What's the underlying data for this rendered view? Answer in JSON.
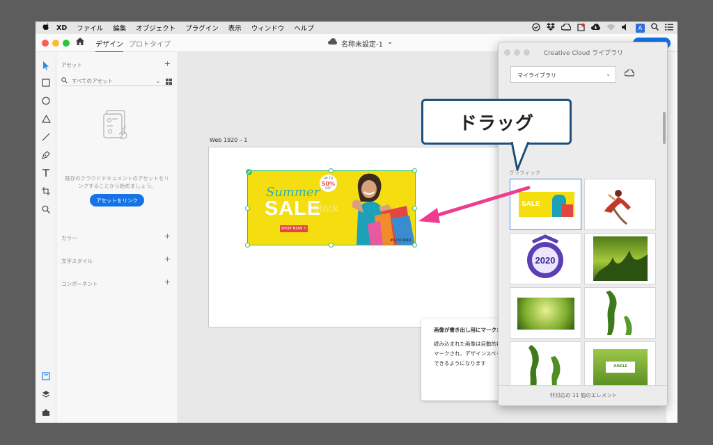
{
  "menubar": {
    "apple": "",
    "items": [
      "XD",
      "ファイル",
      "編集",
      "オブジェクト",
      "プラグイン",
      "表示",
      "ウィンドウ",
      "ヘルプ"
    ],
    "input_badge": "A"
  },
  "titlebar": {
    "tab_design": "デザイン",
    "tab_prototype": "プロトタイプ",
    "doc_title": "名称未設定-1",
    "chevron": "⌄"
  },
  "assets": {
    "header": "アセット",
    "plus": "+",
    "search_label": "すべてのアセット",
    "chevron": "⌄",
    "empty_text": "既存のクラウドドキュメントのアセットをリンクすることから始めましょう。",
    "link_button": "アセットをリンク",
    "sections": [
      "カラー",
      "文字スタイル",
      "コンポーネント"
    ]
  },
  "canvas": {
    "artboard_label": "Web 1920 – 1",
    "banner": {
      "line1": "Summer",
      "line2": "SALE",
      "badge_top": "UP TO",
      "badge_value": "50%",
      "badge_bottom": "OFF",
      "button": "SHOP NOW !!",
      "watermark": "Stock",
      "code": "#22313049"
    }
  },
  "hint": {
    "title": "画像が書き出し用にマークさ",
    "lines": [
      "読み込まれた画像は自動的に",
      "マークされ、デザインスペッ",
      "できるようになります"
    ]
  },
  "cc_library": {
    "title": "Creative Cloud ライブラリ",
    "library_select": "マイライブラリ",
    "chevron": "⌄",
    "section_label": "グラフィック",
    "footer": "非対応の 11 個のエレメント"
  },
  "callout": {
    "text": "ドラッグ"
  },
  "colors": {
    "accent": "#1473e6",
    "selection": "#38c16b",
    "arrow": "#ee3d8e",
    "callout_border": "#1e4f7a",
    "banner_bg": "#f5de10"
  }
}
